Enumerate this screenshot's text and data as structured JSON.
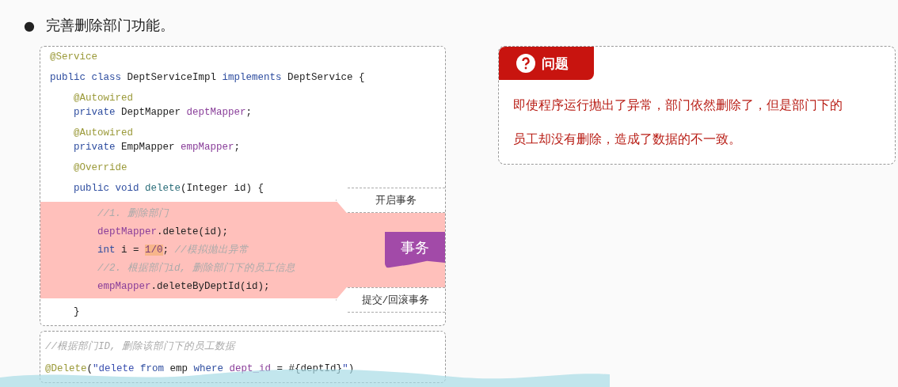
{
  "heading": {
    "bullet": "●",
    "text": "完善删除部门功能。"
  },
  "service_code": {
    "groups": [
      [
        [
          {
            "kind": "annotation",
            "text": "@Service"
          }
        ]
      ],
      [
        [
          {
            "kind": "keyword",
            "text": "public class "
          },
          {
            "kind": "plain",
            "text": "DeptServiceImpl "
          },
          {
            "kind": "keyword",
            "text": "implements "
          },
          {
            "kind": "plain",
            "text": "DeptService {"
          }
        ]
      ],
      [
        [
          {
            "kind": "annotation",
            "text": "    @Autowired"
          }
        ],
        [
          {
            "kind": "keyword",
            "text": "    private "
          },
          {
            "kind": "plain",
            "text": "DeptMapper "
          },
          {
            "kind": "field",
            "text": "deptMapper"
          },
          {
            "kind": "plain",
            "text": ";"
          }
        ]
      ],
      [
        [
          {
            "kind": "annotation",
            "text": "    @Autowired"
          }
        ],
        [
          {
            "kind": "keyword",
            "text": "    private "
          },
          {
            "kind": "plain",
            "text": "EmpMapper "
          },
          {
            "kind": "field",
            "text": "empMapper"
          },
          {
            "kind": "plain",
            "text": ";"
          }
        ]
      ],
      [
        [
          {
            "kind": "annotation",
            "text": "    @Override"
          }
        ]
      ],
      [
        [
          {
            "kind": "keyword",
            "text": "    public void "
          },
          {
            "kind": "method",
            "text": "delete"
          },
          {
            "kind": "plain",
            "text": "(Integer id) {"
          }
        ]
      ]
    ],
    "transaction": {
      "begin_label": "开启事务",
      "tag": "事务",
      "end_label": "提交/回滚事务",
      "lines": [
        [
          {
            "kind": "comment",
            "text": "        //1. 删除部门"
          }
        ],
        [
          {
            "kind": "field",
            "text": "        deptMapper"
          },
          {
            "kind": "plain",
            "text": ".delete(id);"
          }
        ],
        [
          {
            "kind": "keyword",
            "text": "        int "
          },
          {
            "kind": "plain",
            "text": "i = "
          },
          {
            "kind": "highlight",
            "text": "1/0"
          },
          {
            "kind": "plain",
            "text": "; "
          },
          {
            "kind": "comment",
            "text": "//模拟抛出异常"
          }
        ],
        [
          {
            "kind": "comment",
            "text": "        //2. 根据部门id, 删除部门下的员工信息"
          }
        ],
        [
          {
            "kind": "field",
            "text": "        empMapper"
          },
          {
            "kind": "plain",
            "text": ".deleteByDeptId(id);"
          }
        ]
      ]
    },
    "closing": [
      [
        {
          "kind": "plain",
          "text": "    }"
        }
      ]
    ]
  },
  "mapper_code": {
    "lines": [
      [
        {
          "kind": "comment",
          "text": "//根据部门ID, 删除该部门下的员工数据"
        }
      ],
      [
        {
          "kind": "annotation",
          "text": "@Delete"
        },
        {
          "kind": "plain",
          "text": "("
        },
        {
          "kind": "string",
          "text": "\"delete "
        },
        {
          "kind": "keyword",
          "text": "from "
        },
        {
          "kind": "plain",
          "text": "emp "
        },
        {
          "kind": "keyword",
          "text": "where "
        },
        {
          "kind": "field",
          "text": "dept_id "
        },
        {
          "kind": "plain",
          "text": "= #{deptId}"
        },
        {
          "kind": "string",
          "text": "\""
        },
        {
          "kind": "plain",
          "text": ")"
        }
      ]
    ]
  },
  "problem_card": {
    "title": "问题",
    "text": "即使程序运行抛出了异常，部门依然删除了，但是部门下的员工却没有删除，造成了数据的不一致。"
  }
}
